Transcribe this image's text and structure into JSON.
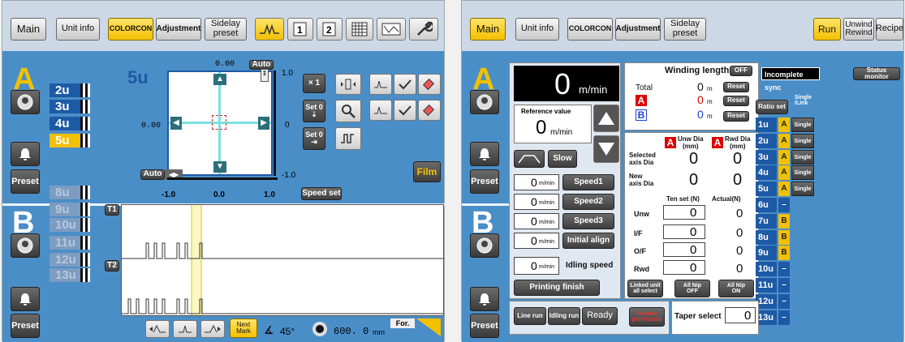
{
  "left": {
    "tabs": [
      "Main",
      "Unit info",
      "COLORCON",
      "Adjustment",
      "Sidelay\npreset"
    ],
    "unit_big_label": "5u",
    "units": [
      "2u",
      "3u",
      "4u",
      "5u",
      "8u",
      "9u",
      "10u",
      "11u",
      "12u",
      "13u"
    ],
    "group_a": "A",
    "group_b": "B",
    "preset_label": "Preset",
    "plot": {
      "top_value": "0.00",
      "left_value": "0.00",
      "auto_label": "Auto",
      "x_ticks": [
        "-1.0",
        "0.0",
        "1.0"
      ],
      "y_ticks": [
        "1.0",
        "0",
        "-1.0"
      ]
    },
    "x1_label": "× 1",
    "set0_label": "Set 0",
    "film_label": "Film",
    "speed_set_label": "Speed set",
    "wave_labels": [
      "T1",
      "T2"
    ],
    "bottom": {
      "next_mark_label": "Next\nMark",
      "angle_value": "45°",
      "length_value": "600. 0",
      "length_unit": "mm",
      "direction_label": "For."
    }
  },
  "right": {
    "tabs": [
      "Main",
      "Unit info",
      "COLORCON",
      "Adjustment",
      "Sidelay\npreset",
      "Run",
      "Unwind\nRewind",
      "Recipe"
    ],
    "group_a": "A",
    "group_b": "B",
    "preset_label": "Preset",
    "speed_display": {
      "value": "0",
      "unit": "m/min"
    },
    "reference": {
      "label": "Reference value",
      "value": "0",
      "unit": "m/min"
    },
    "slow_label": "Slow",
    "speed_rows": [
      {
        "value": "0",
        "unit": "m/min",
        "label": "Speed1"
      },
      {
        "value": "0",
        "unit": "m/min",
        "label": "Speed2"
      },
      {
        "value": "0",
        "unit": "m/min",
        "label": "Speed3"
      },
      {
        "value": "0",
        "unit": "m/min",
        "label": "Initial align"
      }
    ],
    "idling": {
      "value": "0",
      "unit": "m/min",
      "label": "Idling speed"
    },
    "printing_finish_label": "Printing finish",
    "winding": {
      "label": "Winding length",
      "toggle": "OFF",
      "rows": [
        {
          "name": "Total",
          "value": "0",
          "unit": "m",
          "reset": "Reset"
        },
        {
          "name": "A",
          "value": "0",
          "unit": "m",
          "reset": "Reset"
        },
        {
          "name": "B",
          "value": "0",
          "unit": "m",
          "reset": "Reset"
        }
      ]
    },
    "dia": {
      "unw_header": "Unw Dia\n(mm)",
      "rwd_header": "Rwd Dia\n(mm)",
      "rows": [
        {
          "name": "Selected\naxis Dia",
          "unw": "0",
          "rwd": "0"
        },
        {
          "name": "New\naxis Dia",
          "unw": "0",
          "rwd": "0"
        }
      ]
    },
    "tension": {
      "set_header": "Ten set (N)",
      "actual_header": "Actual(N)",
      "rows": [
        {
          "name": "Unw",
          "set": "0",
          "actual": "0"
        },
        {
          "name": "I/F",
          "set": "0",
          "actual": "0"
        },
        {
          "name": "O/F",
          "set": "0",
          "actual": "0"
        },
        {
          "name": "Rwd",
          "set": "0",
          "actual": "0"
        }
      ]
    },
    "nip_buttons": [
      "Linked unit\nall select",
      "All Nip\nOFF",
      "All Nip\nON"
    ],
    "sync_label": "Incomplete sync",
    "status_monitor_label": "Status monitor",
    "ratio_set_label": "Ratio set",
    "link_header": "Single\n/Link",
    "ratio_rows": [
      {
        "unit": "1u",
        "group": "A",
        "link": "Single"
      },
      {
        "unit": "2u",
        "group": "A",
        "link": "Single"
      },
      {
        "unit": "3u",
        "group": "A",
        "link": "Single"
      },
      {
        "unit": "4u",
        "group": "A",
        "link": "Single"
      },
      {
        "unit": "5u",
        "group": "A",
        "link": "Single"
      },
      {
        "unit": "6u",
        "group": "–",
        "link": ""
      },
      {
        "unit": "7u",
        "group": "B",
        "link": ""
      },
      {
        "unit": "8u",
        "group": "B",
        "link": ""
      },
      {
        "unit": "9u",
        "group": "B",
        "link": ""
      },
      {
        "unit": "10u",
        "group": "–",
        "link": ""
      },
      {
        "unit": "11u",
        "group": "–",
        "link": ""
      },
      {
        "unit": "12u",
        "group": "–",
        "link": ""
      },
      {
        "unit": "13u",
        "group": "–",
        "link": ""
      }
    ],
    "bottom": {
      "line_run": "Line run",
      "idling_run": "Idling run",
      "ready": "Ready",
      "operate_permission": "Operate\npermission",
      "taper_label": "Taper select",
      "taper_value": "0"
    }
  }
}
